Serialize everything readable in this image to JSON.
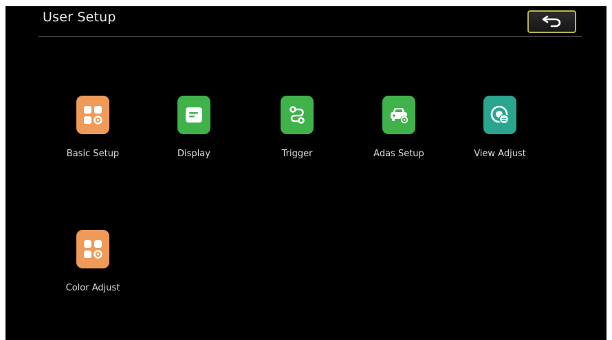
{
  "header": {
    "title": "User Setup",
    "back_icon": "back-arrow-icon"
  },
  "colors": {
    "background": "#000000",
    "orange_tile": "#ee9a59",
    "green_tile": "#3fb24a",
    "teal_tile": "#2aa58e",
    "back_button_border": "#b7b256"
  },
  "menu": {
    "items": [
      {
        "label": "Basic Setup",
        "icon": "grid-gear-icon"
      },
      {
        "label": "Display",
        "icon": "display-text-icon"
      },
      {
        "label": "Trigger",
        "icon": "route-path-icon"
      },
      {
        "label": "Adas Setup",
        "icon": "car-settings-icon"
      },
      {
        "label": "View Adjust",
        "icon": "camera-view-icon"
      },
      {
        "label": "Color Adjust",
        "icon": "grid-gear-icon"
      }
    ]
  }
}
